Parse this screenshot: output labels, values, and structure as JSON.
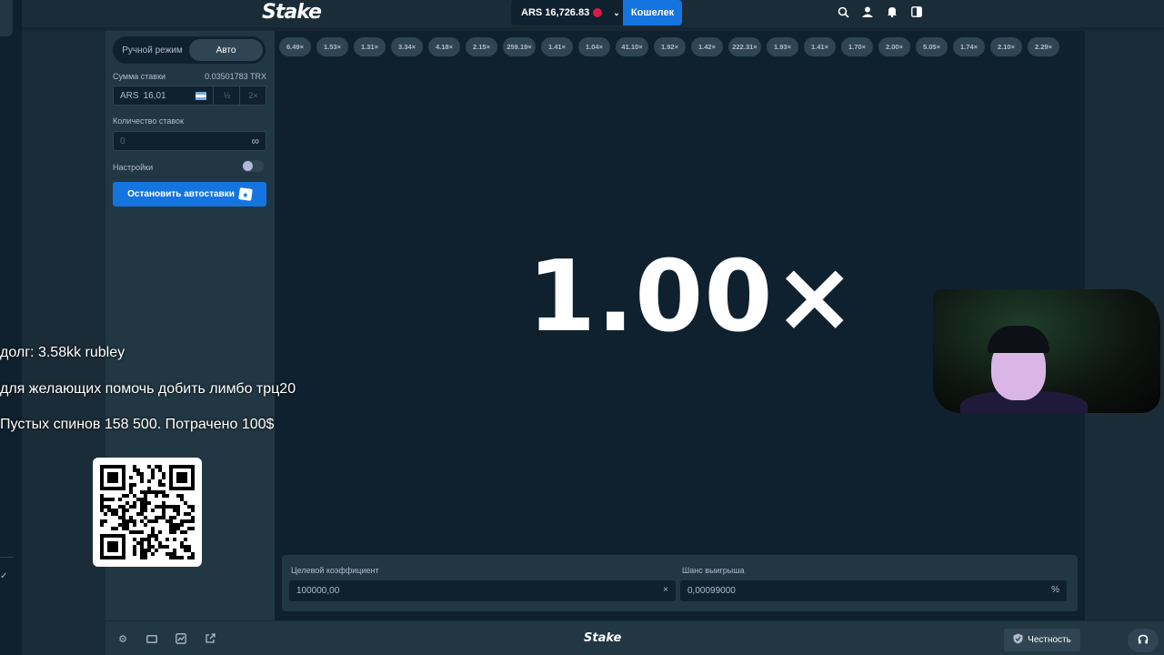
{
  "topbar": {
    "logo": "Stake",
    "balance": "ARS 16,726.83",
    "wallet_label": "Кошелек",
    "icons": [
      "search-icon",
      "user-icon",
      "bell-icon",
      "sidebar-toggle-icon"
    ]
  },
  "panel": {
    "mode_manual": "Ручной режим",
    "mode_auto": "Авто",
    "bet_amount_label": "Сумма ставки",
    "bet_amount_crypto": "0.03501783 TRX",
    "bet_currency": "ARS",
    "bet_value": "16,01",
    "half_label": "½",
    "double_label": "2×",
    "num_bets_label": "Количество ставок",
    "num_bets_value": "0",
    "settings_label": "Настройки",
    "settings_on": false,
    "stop_button": "Остановить автоставки"
  },
  "game": {
    "history": [
      "6.49×",
      "1.53×",
      "1.31×",
      "3.34×",
      "4.18×",
      "2.15×",
      "259.19×",
      "1.41×",
      "1.04×",
      "41.10×",
      "1.92×",
      "1.42×",
      "222.31×",
      "1.93×",
      "1.41×",
      "1.70×",
      "2.00×",
      "5.05×",
      "1.74×",
      "2.10×",
      "2.29×"
    ],
    "multiplier": "1.00×",
    "target_label": "Целевой коэффициент",
    "target_value": "100000,00",
    "target_suffix": "×",
    "win_chance_label": "Шанс выигрыша",
    "win_chance_value": "0,00099000",
    "win_chance_suffix": "%"
  },
  "footer": {
    "logo": "Stake",
    "fairness_label": "Честность",
    "icons": [
      "settings-icon",
      "theatre-mode-icon",
      "stats-icon",
      "popout-icon"
    ]
  },
  "overlay": {
    "debt": "долг: 3.58kk rubley",
    "help": "для желающих помочь добить лимбо трц20",
    "spins": "Пустых спинов 158 500. Потрачено 100$"
  },
  "colors": {
    "background": "#1a2c38",
    "panel": "#213743",
    "game_bg": "#0f212e",
    "accent": "#1475e1",
    "pill": "#2f4553"
  }
}
